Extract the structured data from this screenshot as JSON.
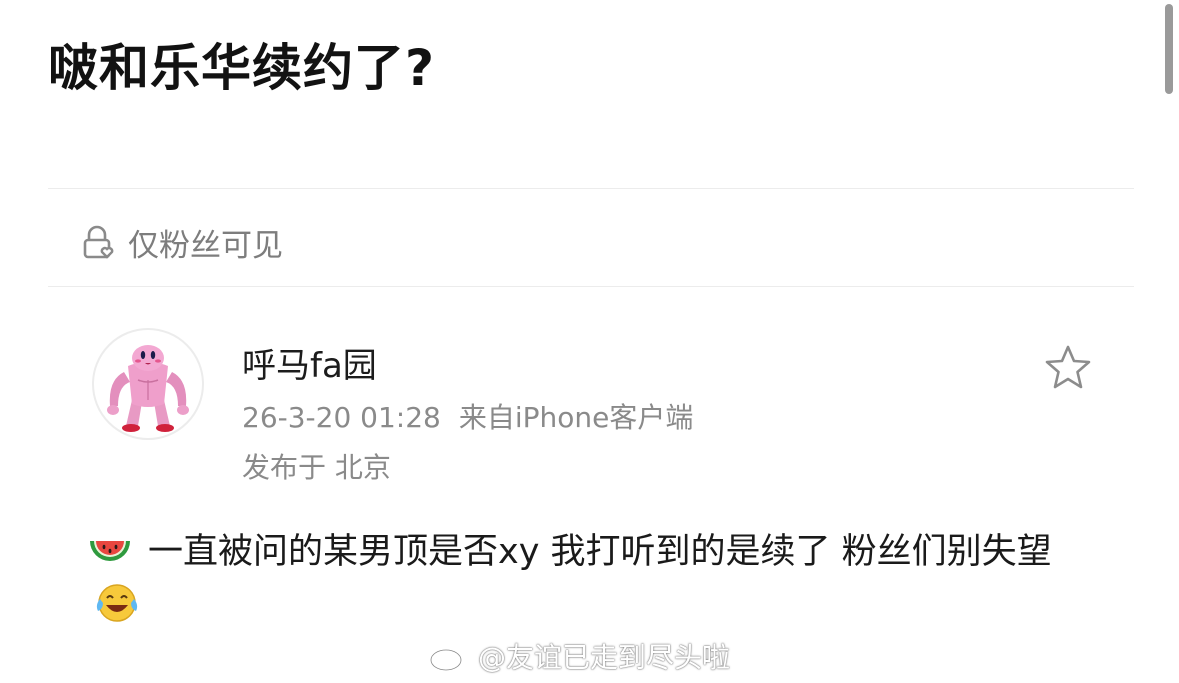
{
  "question": {
    "title": "啵和乐华续约了?"
  },
  "visibility": {
    "icon": "lock-heart-icon",
    "label": "仅粉丝可见"
  },
  "post": {
    "username": "呼马fa园",
    "date": "26-3-20 01:28",
    "source": "来自iPhone客户端",
    "location": "发布于 北京",
    "content": "一直被问的某男顶是否xy 我打听到的是续了 粉丝们别失望",
    "leading_emoji": "watermelon-icon",
    "trailing_emoji": "laughing-tears-icon",
    "favorite_icon": "star-icon",
    "avatar": "pink-muscle-kirby-avatar"
  },
  "watermark": {
    "text": "@友谊已走到尽头啦",
    "icon": "weibo-icon"
  }
}
